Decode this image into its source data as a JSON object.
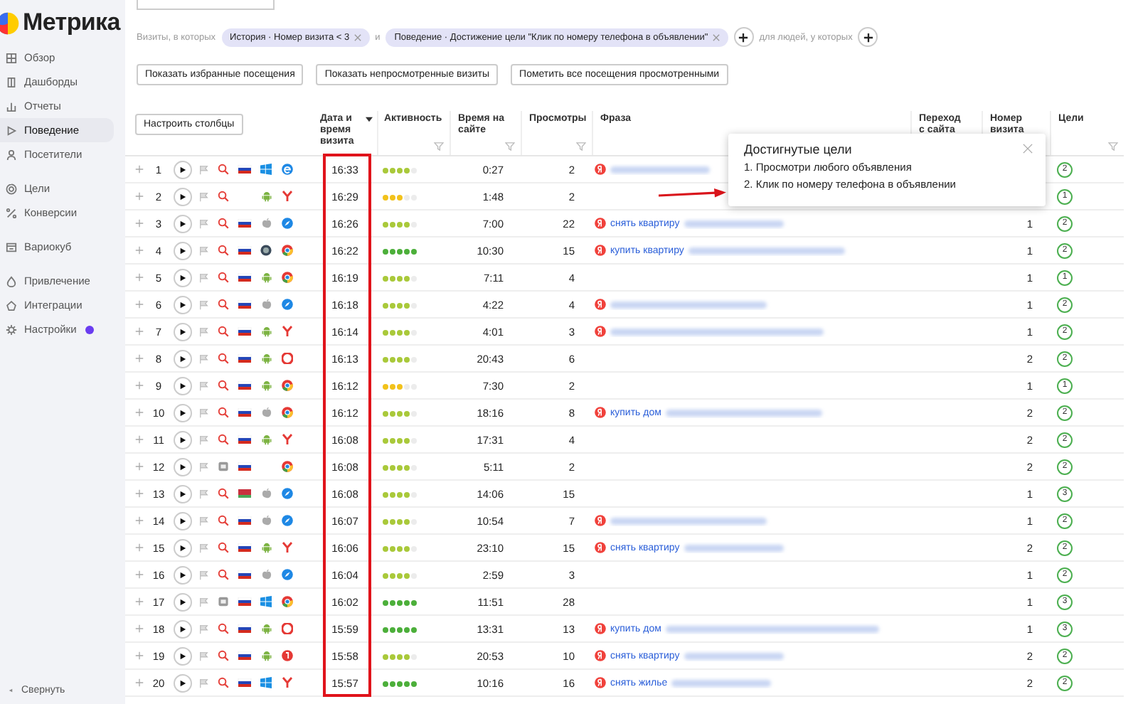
{
  "logo": {
    "text": "Метрика"
  },
  "sidebar": {
    "sections": [
      [
        {
          "label": "Обзор",
          "selected": false,
          "notification": false
        },
        {
          "label": "Дашборды",
          "selected": false,
          "notification": false
        },
        {
          "label": "Отчеты",
          "selected": false,
          "notification": false
        },
        {
          "label": "Поведение",
          "selected": true,
          "notification": false
        },
        {
          "label": "Посетители",
          "selected": false,
          "notification": false
        }
      ],
      [
        {
          "label": "Цели",
          "selected": false,
          "notification": false
        },
        {
          "label": "Конверсии",
          "selected": false,
          "notification": false
        }
      ],
      [
        {
          "label": "Вариокуб",
          "selected": false,
          "notification": false
        }
      ],
      [
        {
          "label": "Привлечение",
          "selected": false,
          "notification": false
        },
        {
          "label": "Интеграции",
          "selected": false,
          "notification": false
        },
        {
          "label": "Настройки",
          "selected": false,
          "notification": true
        }
      ]
    ],
    "collapse": "Свернуть"
  },
  "filters": {
    "prefix": "Визиты, в которых",
    "conditions": [
      {
        "text": "История · Номер визита < 3"
      },
      {
        "text": "Поведение · Достижение цели \"Клик по номеру телефона в объявлении\""
      }
    ],
    "joiner": "и",
    "people_label": "для людей, у которых"
  },
  "actions": [
    "Показать избранные посещения",
    "Показать непросмотренные визиты",
    "Пометить все посещения просмотренными"
  ],
  "table": {
    "configure_button": "Настроить столбцы",
    "columns": [
      {
        "label": "Дата и время визита",
        "sorted": true,
        "filter": false
      },
      {
        "label": "Активность",
        "sorted": false,
        "filter": true
      },
      {
        "label": "Время на сайте",
        "sorted": false,
        "filter": true
      },
      {
        "label": "Просмотры",
        "sorted": false,
        "filter": true
      },
      {
        "label": "Фраза",
        "sorted": false
      },
      {
        "label": "Переход с сайта",
        "sorted": false
      },
      {
        "label": "Номер визита",
        "sorted": false
      },
      {
        "label": "Цели",
        "sorted": false,
        "filter": true
      }
    ],
    "rows": [
      {
        "number": "1",
        "source": {
          "kind": "search"
        },
        "flag": {
          "kind": "ru"
        },
        "os": {
          "kind": "windows"
        },
        "browser": {
          "kind": "edge"
        },
        "time": "16:33",
        "stars": 4,
        "duration": "0:27",
        "views": "2",
        "engine": {
          "kind": "yandex"
        },
        "blurred": {
          "kind": "short"
        },
        "goals": "2"
      },
      {
        "number": "2",
        "source": {
          "kind": "search"
        },
        "os": {
          "kind": "android"
        },
        "browser": {
          "kind": "yandex"
        },
        "time": "16:29",
        "stars": 3,
        "duration": "1:48",
        "views": "2",
        "goals": "1"
      },
      {
        "number": "3",
        "source": {
          "kind": "search"
        },
        "flag": {
          "kind": "ru"
        },
        "os": {
          "kind": "apple"
        },
        "browser": {
          "kind": "safari"
        },
        "time": "16:26",
        "stars": 4,
        "duration": "7:00",
        "views": "22",
        "engine": {
          "kind": "yandex"
        },
        "phrase": "снять квартиру",
        "blurred": {
          "kind": "short"
        },
        "visit_number": "1",
        "goals": "2"
      },
      {
        "number": "4",
        "source": {
          "kind": "search"
        },
        "flag": {
          "kind": "ru"
        },
        "os": {
          "kind": "other"
        },
        "browser": {
          "kind": "chrome"
        },
        "time": "16:22",
        "stars": 5,
        "duration": "10:30",
        "views": "15",
        "engine": {
          "kind": "yandex"
        },
        "phrase": "купить квартиру",
        "blurred": {
          "kind": "long"
        },
        "visit_number": "1",
        "goals": "2"
      },
      {
        "number": "5",
        "source": {
          "kind": "search"
        },
        "flag": {
          "kind": "ru"
        },
        "os": {
          "kind": "android"
        },
        "browser": {
          "kind": "chrome"
        },
        "time": "16:19",
        "stars": 4,
        "duration": "7:11",
        "views": "4",
        "visit_number": "1",
        "goals": "1"
      },
      {
        "number": "6",
        "source": {
          "kind": "search"
        },
        "flag": {
          "kind": "ru"
        },
        "os": {
          "kind": "apple"
        },
        "browser": {
          "kind": "safari"
        },
        "time": "16:18",
        "stars": 4,
        "duration": "4:22",
        "views": "4",
        "engine": {
          "kind": "yandex"
        },
        "blurred": {
          "kind": "long"
        },
        "visit_number": "1",
        "goals": "2"
      },
      {
        "number": "7",
        "source": {
          "kind": "search"
        },
        "flag": {
          "kind": "ru"
        },
        "os": {
          "kind": "android"
        },
        "browser": {
          "kind": "yandex"
        },
        "time": "16:14",
        "stars": 4,
        "duration": "4:01",
        "views": "3",
        "engine": {
          "kind": "yandex"
        },
        "blurred": {
          "kind": "xlong"
        },
        "visit_number": "1",
        "goals": "2"
      },
      {
        "number": "8",
        "source": {
          "kind": "search"
        },
        "flag": {
          "kind": "ru"
        },
        "os": {
          "kind": "android"
        },
        "browser": {
          "kind": "opera"
        },
        "time": "16:13",
        "stars": 4,
        "duration": "20:43",
        "views": "6",
        "visit_number": "2",
        "goals": "2"
      },
      {
        "number": "9",
        "source": {
          "kind": "search"
        },
        "flag": {
          "kind": "ru"
        },
        "os": {
          "kind": "android"
        },
        "browser": {
          "kind": "chrome"
        },
        "time": "16:12",
        "stars": 3,
        "duration": "7:30",
        "views": "2",
        "visit_number": "1",
        "goals": "1"
      },
      {
        "number": "10",
        "source": {
          "kind": "search"
        },
        "flag": {
          "kind": "ru"
        },
        "os": {
          "kind": "apple"
        },
        "browser": {
          "kind": "chrome"
        },
        "time": "16:12",
        "stars": 4,
        "duration": "18:16",
        "views": "8",
        "engine": {
          "kind": "yandex"
        },
        "phrase": "купить дом",
        "blurred": {
          "kind": "long"
        },
        "visit_number": "2",
        "goals": "2"
      },
      {
        "number": "11",
        "source": {
          "kind": "search"
        },
        "flag": {
          "kind": "ru"
        },
        "os": {
          "kind": "android"
        },
        "browser": {
          "kind": "yandex"
        },
        "time": "16:08",
        "stars": 4,
        "duration": "17:31",
        "views": "4",
        "visit_number": "2",
        "goals": "2"
      },
      {
        "number": "12",
        "source": {
          "kind": "direct"
        },
        "flag": {
          "kind": "ru"
        },
        "browser": {
          "kind": "chrome"
        },
        "time": "16:08",
        "stars": 4,
        "duration": "5:11",
        "views": "2",
        "visit_number": "2",
        "goals": "2"
      },
      {
        "number": "13",
        "source": {
          "kind": "search"
        },
        "flag": {
          "kind": "by"
        },
        "os": {
          "kind": "apple"
        },
        "browser": {
          "kind": "safari"
        },
        "time": "16:08",
        "stars": 4,
        "duration": "14:06",
        "views": "15",
        "visit_number": "1",
        "goals": "3"
      },
      {
        "number": "14",
        "source": {
          "kind": "search"
        },
        "flag": {
          "kind": "ru"
        },
        "os": {
          "kind": "apple"
        },
        "browser": {
          "kind": "safari"
        },
        "time": "16:07",
        "stars": 4,
        "duration": "10:54",
        "views": "7",
        "engine": {
          "kind": "yandex"
        },
        "blurred": {
          "kind": "long"
        },
        "visit_number": "1",
        "goals": "2"
      },
      {
        "number": "15",
        "source": {
          "kind": "search"
        },
        "flag": {
          "kind": "ru"
        },
        "os": {
          "kind": "android"
        },
        "browser": {
          "kind": "yandex"
        },
        "time": "16:06",
        "stars": 4,
        "duration": "23:10",
        "views": "15",
        "engine": {
          "kind": "yandex"
        },
        "phrase": "снять квартиру",
        "blurred": {
          "kind": "short"
        },
        "visit_number": "2",
        "goals": "2"
      },
      {
        "number": "16",
        "source": {
          "kind": "search"
        },
        "flag": {
          "kind": "ru"
        },
        "os": {
          "kind": "apple"
        },
        "browser": {
          "kind": "safari"
        },
        "time": "16:04",
        "stars": 4,
        "duration": "2:59",
        "views": "3",
        "visit_number": "1",
        "goals": "2"
      },
      {
        "number": "17",
        "source": {
          "kind": "direct"
        },
        "flag": {
          "kind": "ru"
        },
        "os": {
          "kind": "windows"
        },
        "browser": {
          "kind": "chrome"
        },
        "time": "16:02",
        "stars": 5,
        "duration": "11:51",
        "views": "28",
        "visit_number": "1",
        "goals": "3"
      },
      {
        "number": "18",
        "source": {
          "kind": "search"
        },
        "flag": {
          "kind": "ru"
        },
        "os": {
          "kind": "android"
        },
        "browser": {
          "kind": "opera"
        },
        "time": "15:59",
        "stars": 5,
        "duration": "13:31",
        "views": "13",
        "engine": {
          "kind": "yandex"
        },
        "phrase": "купить дом",
        "blurred": {
          "kind": "xlong"
        },
        "visit_number": "1",
        "goals": "3"
      },
      {
        "number": "19",
        "source": {
          "kind": "search"
        },
        "flag": {
          "kind": "ru"
        },
        "os": {
          "kind": "android"
        },
        "browser": {
          "kind": "yabrowser"
        },
        "time": "15:58",
        "stars": 4,
        "duration": "20:53",
        "views": "10",
        "engine": {
          "kind": "yandex"
        },
        "phrase": "снять квартиру",
        "blurred": {
          "kind": "short"
        },
        "visit_number": "2",
        "goals": "2"
      },
      {
        "number": "20",
        "source": {
          "kind": "search"
        },
        "flag": {
          "kind": "ru"
        },
        "os": {
          "kind": "windows"
        },
        "browser": {
          "kind": "yandex"
        },
        "time": "15:57",
        "stars": 5,
        "duration": "10:16",
        "views": "16",
        "engine": {
          "kind": "yandex"
        },
        "phrase": "снять жилье",
        "blurred": {
          "kind": "short"
        },
        "visit_number": "2",
        "goals": "2"
      }
    ]
  },
  "popup": {
    "title": "Достигнутые цели",
    "items": [
      "1. Просмотри любого объявления",
      "2. Клик по номеру телефона в объявлении"
    ]
  }
}
